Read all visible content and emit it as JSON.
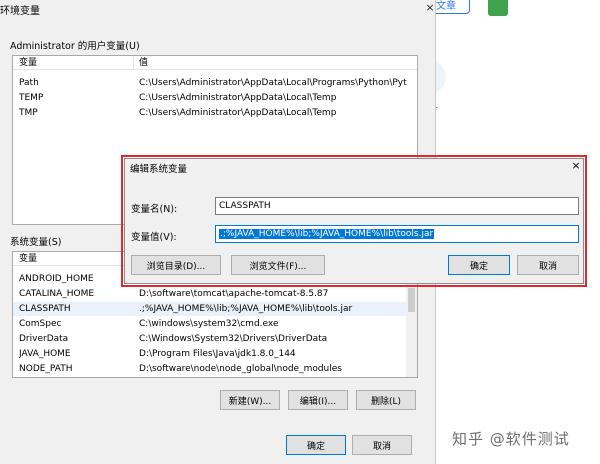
{
  "background": {
    "write_article": "文章",
    "digit": "1",
    "watermark": "知乎 @软件测试"
  },
  "env_window": {
    "title": "环境变量",
    "close_symbol": "×",
    "user_vars": {
      "label": "Administrator 的用户变量(U)",
      "headers": [
        "变量",
        "值"
      ],
      "rows": [
        {
          "name": "Path",
          "value": "C:\\Users\\Administrator\\AppData\\Local\\Programs\\Python\\Pyt..."
        },
        {
          "name": "TEMP",
          "value": "C:\\Users\\Administrator\\AppData\\Local\\Temp"
        },
        {
          "name": "TMP",
          "value": "C:\\Users\\Administrator\\AppData\\Local\\Temp"
        }
      ]
    },
    "system_vars": {
      "label": "系统变量(S)",
      "headers": [
        "变量",
        "值"
      ],
      "rows": [
        {
          "name": "ANDROID_HOME",
          "value": ""
        },
        {
          "name": "CATALINA_HOME",
          "value": "D:\\software\\tomcat\\apache-tomcat-8.5.87"
        },
        {
          "name": "CLASSPATH",
          "value": ".;%JAVA_HOME%\\lib;%JAVA_HOME%\\lib\\tools.jar"
        },
        {
          "name": "ComSpec",
          "value": "C:\\windows\\system32\\cmd.exe"
        },
        {
          "name": "DriverData",
          "value": "C:\\Windows\\System32\\Drivers\\DriverData"
        },
        {
          "name": "JAVA_HOME",
          "value": "D:\\Program Files\\Java\\jdk1.8.0_144"
        },
        {
          "name": "NODE_PATH",
          "value": "D:\\software\\node\\node_global\\node_modules"
        }
      ],
      "buttons": {
        "new": "新建(W)...",
        "edit": "编辑(I)...",
        "delete": "删除(L)"
      }
    },
    "ok": "确定",
    "cancel": "取消"
  },
  "edit_dialog": {
    "title": "编辑系统变量",
    "close_symbol": "×",
    "name_label": "变量名(N):",
    "name_value": "CLASSPATH",
    "value_label": "变量值(V):",
    "value_value": ".;%JAVA_HOME%\\lib;%JAVA_HOME%\\lib\\tools.jar",
    "browse_dir": "浏览目录(D)...",
    "browse_file": "浏览文件(F)...",
    "ok": "确定",
    "cancel": "取消"
  },
  "colors": {
    "highlight_frame": "#e0282e",
    "selection": "#0078d7",
    "accent_link": "#2a79e6"
  }
}
